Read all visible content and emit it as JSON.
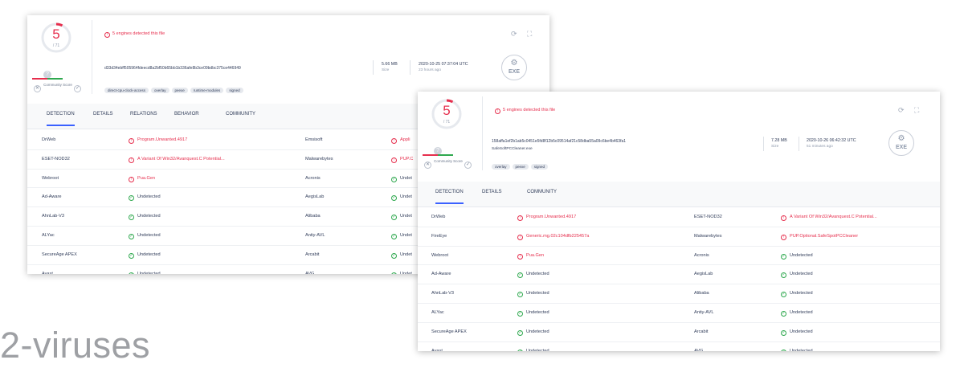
{
  "colors": {
    "malicious": "#e62e4d",
    "clean": "#2fa84f",
    "accent": "#3b61ff"
  },
  "watermark": "2-viruses",
  "report_a": {
    "score": {
      "detected": "5",
      "total": "/ 71"
    },
    "alert": "5 engines detected this file",
    "community": {
      "label": "Community Score"
    },
    "hash": "d33d34ebff505964fdeecd8a2bf50b65bb1b336afe8b3ce09bdbc375ce446949",
    "tags": [
      "direct-cpu-clock-access",
      "overlay",
      "peexe",
      "runtime-modules",
      "signed"
    ],
    "size": {
      "value": "5.66 MB",
      "label": "Size"
    },
    "date": {
      "value": "2020-10-25 07:37:04 UTC",
      "label": "23 hours ago"
    },
    "filetype": "EXE",
    "tabs": [
      "DETECTION",
      "DETAILS",
      "RELATIONS",
      "BEHAVIOR",
      "COMMUNITY"
    ],
    "rows": [
      {
        "e1": "DrWeb",
        "r1": "Program.Unwanted.4917",
        "s1": "bad",
        "e2": "Emsisoft",
        "r2": "Appli",
        "s2": "bad"
      },
      {
        "e1": "ESET-NOD32",
        "r1": "A Variant Of Win32/Avanquest.C Potential...",
        "s1": "bad",
        "e2": "Malwarebytes",
        "r2": "PUP.C",
        "s2": "bad"
      },
      {
        "e1": "Webroot",
        "r1": "Pua.Gen",
        "s1": "bad",
        "e2": "Acronis",
        "r2": "Undet",
        "s2": "good"
      },
      {
        "e1": "Ad-Aware",
        "r1": "Undetected",
        "s1": "good",
        "e2": "AegisLab",
        "r2": "Undet",
        "s2": "good"
      },
      {
        "e1": "AhnLab-V3",
        "r1": "Undetected",
        "s1": "good",
        "e2": "Alibaba",
        "r2": "Undet",
        "s2": "good"
      },
      {
        "e1": "ALYac",
        "r1": "Undetected",
        "s1": "good",
        "e2": "Antiy-AVL",
        "r2": "Undet",
        "s2": "good"
      },
      {
        "e1": "SecureAge APEX",
        "r1": "Undetected",
        "s1": "good",
        "e2": "Arcabit",
        "r2": "Undet",
        "s2": "good"
      },
      {
        "e1": "Avast",
        "r1": "Undetected",
        "s1": "good",
        "e2": "AVG",
        "r2": "Undet",
        "s2": "good"
      }
    ]
  },
  "report_b": {
    "score": {
      "detected": "5",
      "total": "/ 71"
    },
    "alert": "5 engines detected this file",
    "community": {
      "label": "Community Score"
    },
    "hash": "158affa1ef2b1ab5c0451e5fd8f12b5c09514af21c58dba55a09c6be4b463fa1",
    "filename": "SafeSoftPCCleaner.exe",
    "tags": [
      "overlay",
      "peexe",
      "signed"
    ],
    "size": {
      "value": "7.28 MB",
      "label": "Size"
    },
    "date": {
      "value": "2020-10-26 06:42:32 UTC",
      "label": "51 minutes ago"
    },
    "filetype": "EXE",
    "tabs": [
      "DETECTION",
      "DETAILS",
      "COMMUNITY"
    ],
    "rows": [
      {
        "e1": "DrWeb",
        "r1": "Program.Unwanted.4917",
        "s1": "bad",
        "e2": "ESET-NOD32",
        "r2": "A Variant Of Win32/Avanquest.C Potential...",
        "s2": "bad"
      },
      {
        "e1": "FireEye",
        "r1": "Generic.mg.02c104dfb225457a",
        "s1": "bad",
        "e2": "Malwarebytes",
        "r2": "PUP.Optional.SafeSpotPCCleaner",
        "s2": "bad"
      },
      {
        "e1": "Webroot",
        "r1": "Pua.Gen",
        "s1": "bad",
        "e2": "Acronis",
        "r2": "Undetected",
        "s2": "good"
      },
      {
        "e1": "Ad-Aware",
        "r1": "Undetected",
        "s1": "good",
        "e2": "AegisLab",
        "r2": "Undetected",
        "s2": "good"
      },
      {
        "e1": "AhnLab-V3",
        "r1": "Undetected",
        "s1": "good",
        "e2": "Alibaba",
        "r2": "Undetected",
        "s2": "good"
      },
      {
        "e1": "ALYac",
        "r1": "Undetected",
        "s1": "good",
        "e2": "Antiy-AVL",
        "r2": "Undetected",
        "s2": "good"
      },
      {
        "e1": "SecureAge APEX",
        "r1": "Undetected",
        "s1": "good",
        "e2": "Arcabit",
        "r2": "Undetected",
        "s2": "good"
      },
      {
        "e1": "Avast",
        "r1": "Undetected",
        "s1": "good",
        "e2": "AVG",
        "r2": "Undetected",
        "s2": "good"
      }
    ]
  }
}
